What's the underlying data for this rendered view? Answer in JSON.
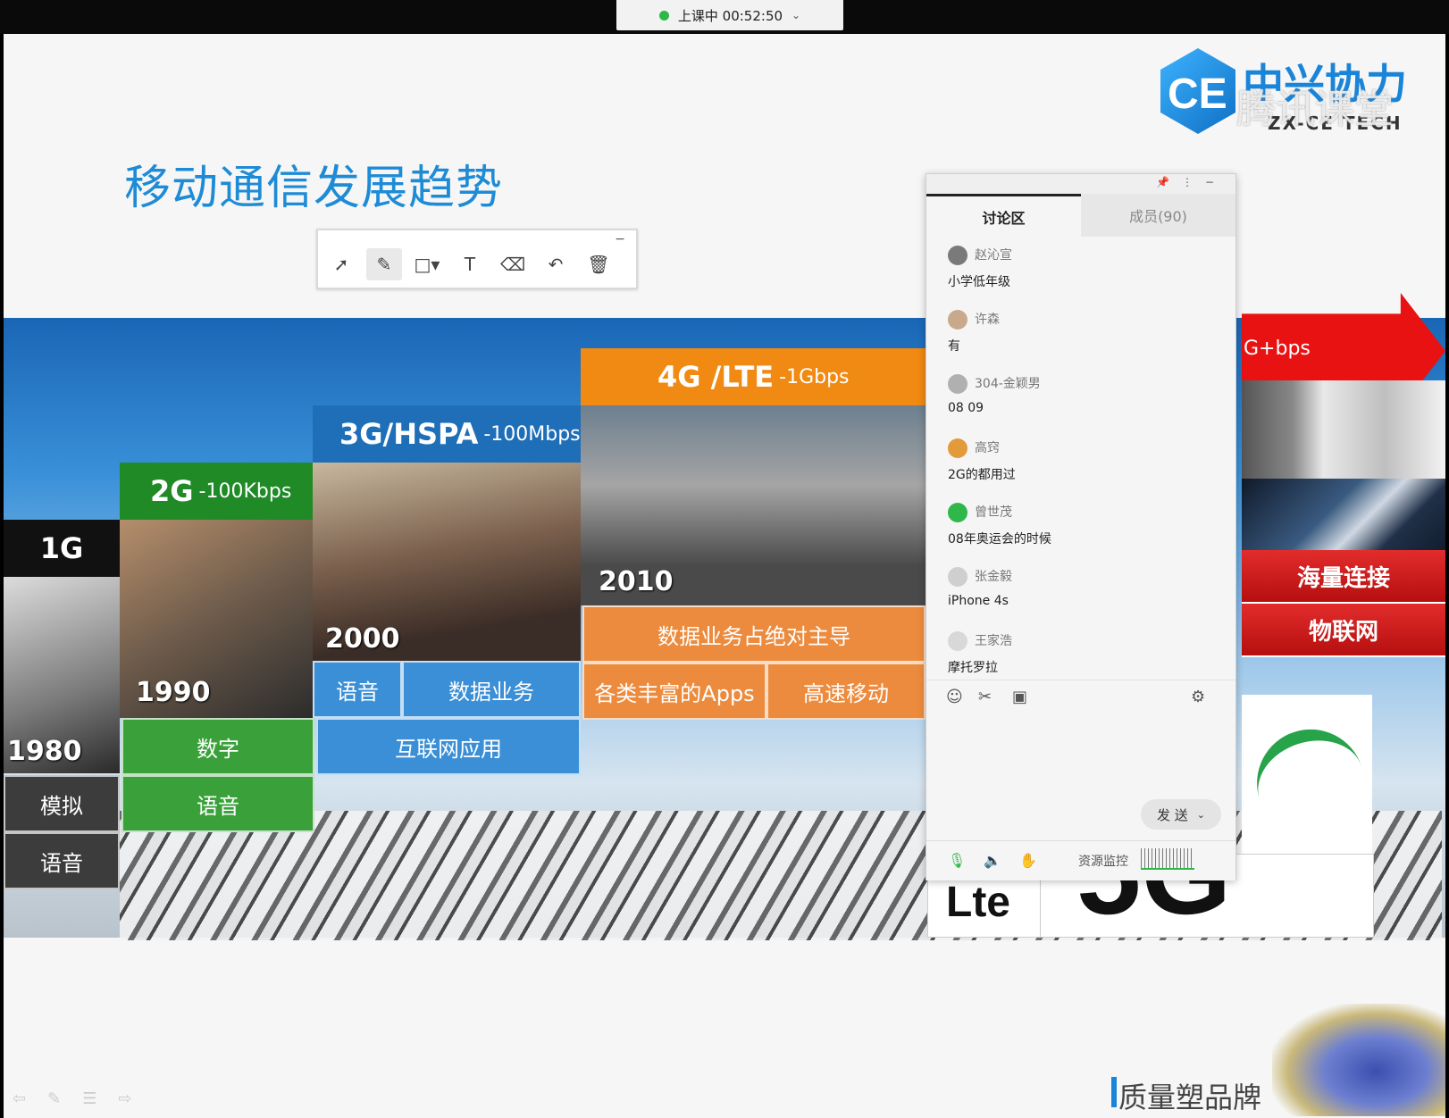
{
  "status": {
    "text": "上课中 00:52:50",
    "dot_color": "#2fb84a"
  },
  "slide": {
    "title": "移动通信发展趋势",
    "watermark": "腾讯课堂",
    "logo": {
      "mark": "CE",
      "cn": "中兴协力",
      "en": "ZX-CE TECH"
    },
    "footer": "质量塑品牌"
  },
  "toolbar": {
    "minimize": "−",
    "tools": [
      {
        "name": "pointer-tool",
        "glyph": "➚"
      },
      {
        "name": "pen-tool",
        "glyph": "✎",
        "active": true
      },
      {
        "name": "shape-tool",
        "glyph": "□▾"
      },
      {
        "name": "text-tool",
        "glyph": "T"
      },
      {
        "name": "eraser-tool",
        "glyph": "⌫"
      },
      {
        "name": "undo-tool",
        "glyph": "↶"
      },
      {
        "name": "delete-tool",
        "glyph": "🗑"
      }
    ]
  },
  "generations": {
    "g1": {
      "label": "1G",
      "year": "1980",
      "cells": [
        "模拟",
        "语音"
      ]
    },
    "g2": {
      "label": "2G",
      "speed": "-100Kbps",
      "year": "1990",
      "cells": [
        "数字",
        "语音"
      ]
    },
    "g3": {
      "label": "3G/HSPA",
      "speed": "-100Mbps",
      "year": "2000",
      "cells": [
        "语音",
        "数据业务",
        "互联网应用"
      ]
    },
    "g4": {
      "label": "4G /LTE",
      "speed": "-1Gbps",
      "year": "2010",
      "cells": [
        "数据业务占绝对主导",
        "各类丰富的Apps",
        "高速移动"
      ]
    },
    "g5": {
      "speed": "G+bps",
      "cells": [
        "海量连接",
        "物联网"
      ],
      "lte_logo": "Lte",
      "big_text": "5G"
    }
  },
  "colors": {
    "g1": "#111111",
    "g2": "#1f8a26",
    "g3": "#1f6fb8",
    "g4": "#f08a12",
    "g5": "#e81212"
  },
  "chat": {
    "tabs": [
      {
        "label": "讨论区",
        "active": true
      },
      {
        "label": "成员(90)",
        "active": false
      }
    ],
    "messages": [
      {
        "user": "赵沁宣",
        "text": "小学低年级"
      },
      {
        "user": "许森",
        "text": "有"
      },
      {
        "user": "304-金颖男",
        "text": "08 09"
      },
      {
        "user": "高窍",
        "text": "2G的都用过"
      },
      {
        "user": "曾世茂",
        "text": "08年奥运会的时候"
      },
      {
        "user": "张金毅",
        "text": "iPhone 4s"
      },
      {
        "user": "王家浩",
        "text": "摩托罗拉"
      }
    ],
    "send_label": "发 送",
    "monitor_label": "资源监控"
  }
}
